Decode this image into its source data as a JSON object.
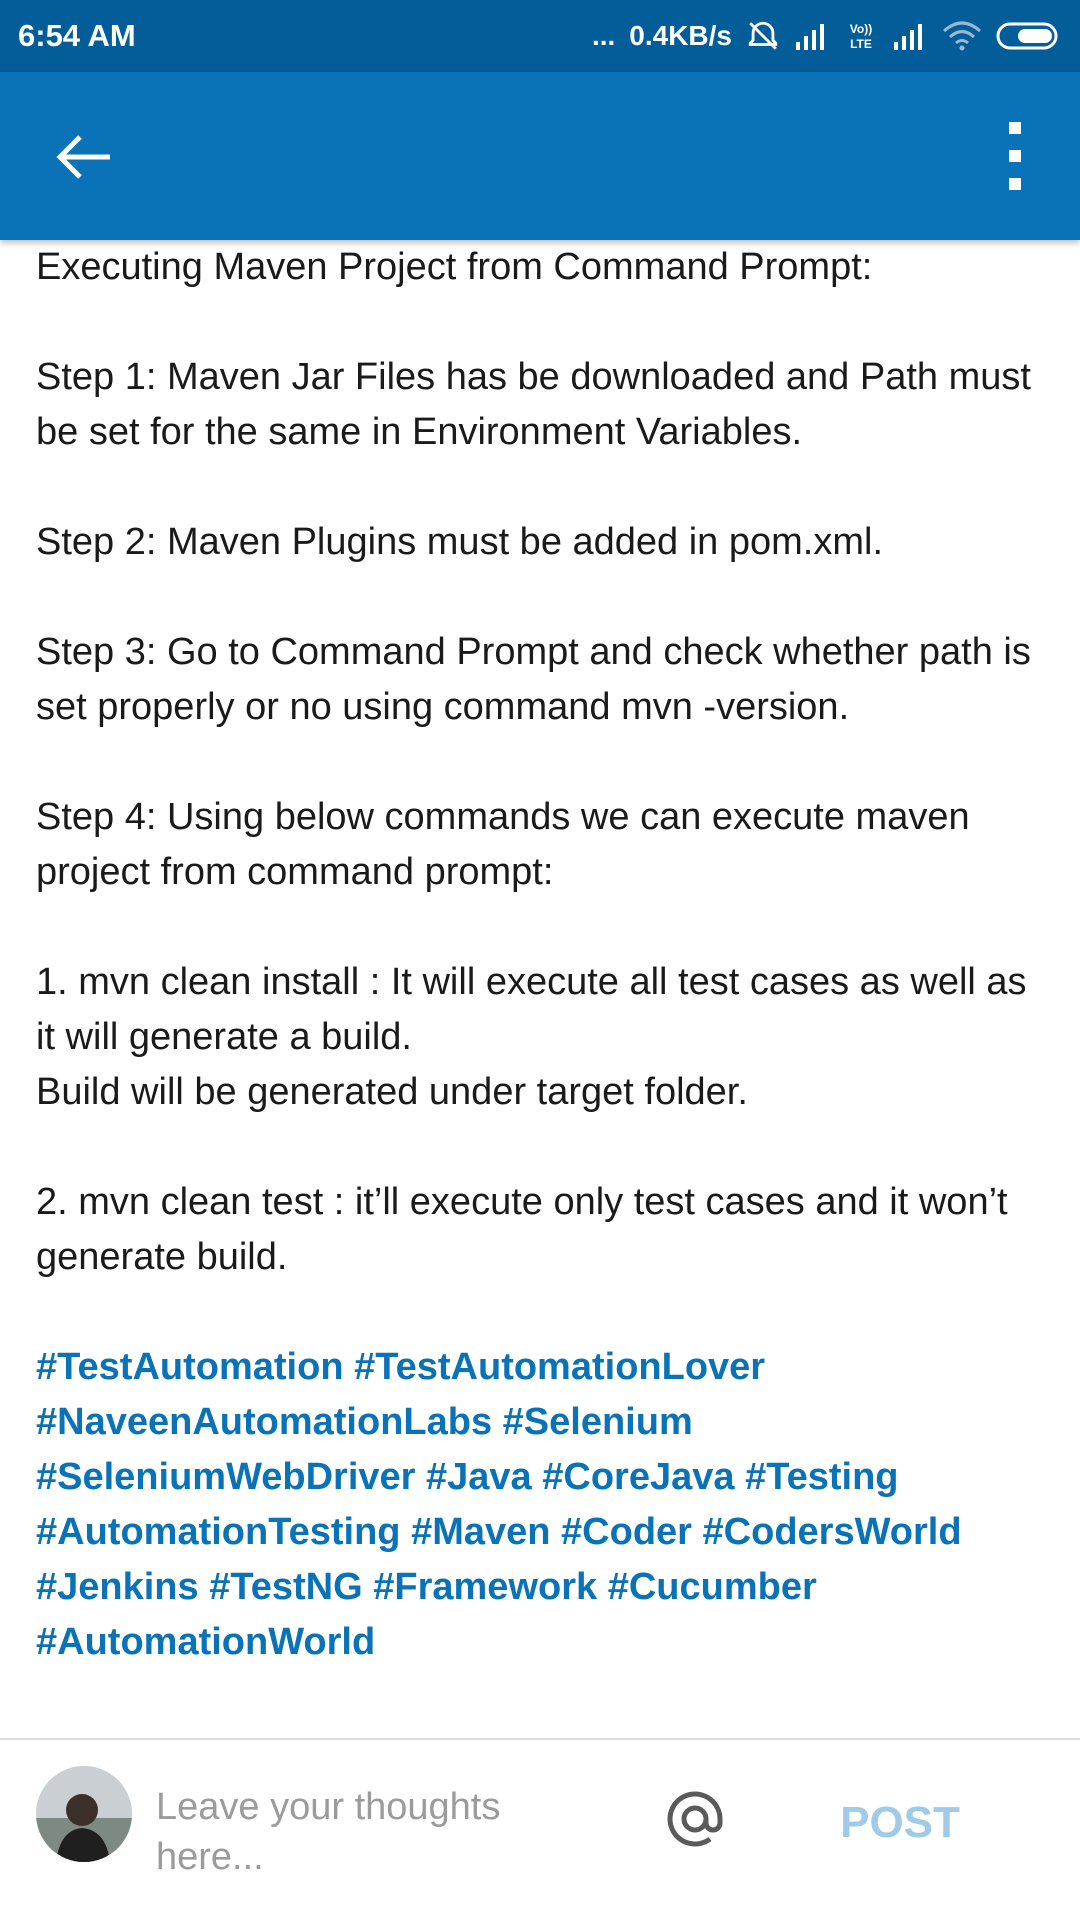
{
  "status_bar": {
    "time": "6:54 AM",
    "dots": "...",
    "net_speed": "0.4KB/s",
    "volte": "Vo)) LTE",
    "icons": [
      "alarm-off-icon",
      "signal-icon",
      "volte-icon",
      "signal-icon",
      "wifi-icon",
      "battery-icon"
    ]
  },
  "app_bar": {
    "back_icon": "arrow-left-icon",
    "menu_icon": "more-vertical-icon",
    "color": "#0a73b7"
  },
  "post": {
    "paragraphs": [
      "Executing Maven Project from Command Prompt:",
      "Step 1: Maven Jar Files has be downloaded and Path must be set for the same in Environment Variables.",
      "Step 2: Maven Plugins must be added in pom.xml.",
      "Step 3: Go to Command Prompt and check whether path is set properly or no using command mvn -version.",
      "Step 4: Using below commands we can execute maven project from command prompt:",
      "1. mvn clean install : It will execute all test cases as well as it will generate a build.",
      "Build will be generated under target folder.",
      "2. mvn clean test : it’ll execute only test cases and it won’t generate build."
    ],
    "hashtags": [
      "#TestAutomation",
      "#TestAutomationLover",
      "#NaveenAutomationLabs",
      "#Selenium",
      "#SeleniumWebDriver",
      "#Java",
      "#CoreJava",
      "#Testing",
      "#AutomationTesting",
      "#Maven",
      "#Coder",
      "#CodersWorld",
      "#Jenkins",
      "#TestNG",
      "#Framework",
      "#Cucumber",
      "#AutomationWorld"
    ],
    "hashtag_color": "#0a73b7"
  },
  "comment_bar": {
    "placeholder": "Leave your thoughts here...",
    "mention_icon": "at-sign-icon",
    "post_label": "POST",
    "post_color": "#9fcbe8"
  }
}
